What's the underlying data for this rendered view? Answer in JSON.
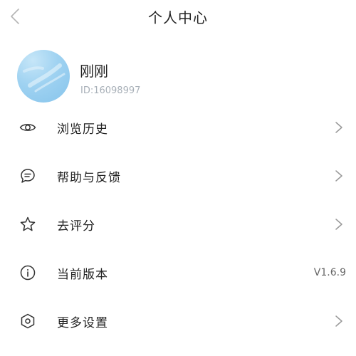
{
  "header": {
    "title": "个人中心",
    "back_icon": "chevron-left-icon"
  },
  "profile": {
    "name": "刚刚",
    "id_text": "ID:16098997",
    "avatar": "sky-avatar"
  },
  "menu": [
    {
      "label": "浏览历史",
      "icon": "eye-icon",
      "trailing": "chevron-right-icon"
    },
    {
      "label": "帮助与反馈",
      "icon": "chat-bubble-icon",
      "trailing": "chevron-right-icon"
    },
    {
      "label": "去评分",
      "icon": "star-icon",
      "trailing": "chevron-right-icon"
    },
    {
      "label": "当前版本",
      "icon": "info-icon",
      "value": "V1.6.9"
    },
    {
      "label": "更多设置",
      "icon": "hexagon-settings-icon",
      "trailing": "chevron-right-icon"
    }
  ],
  "colors": {
    "text": "#222222",
    "muted": "#a8b0b8",
    "icon": "#333333",
    "chevron": "#aaaaaa"
  }
}
